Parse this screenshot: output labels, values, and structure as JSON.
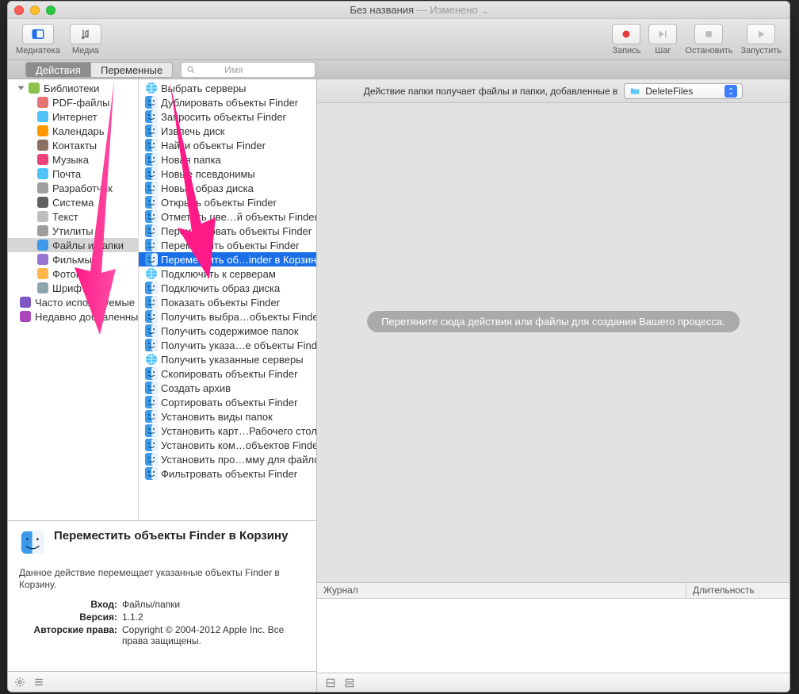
{
  "titlebar": {
    "title": "Без названия",
    "status": "Изменено"
  },
  "toolbar": {
    "library": "Медиатека",
    "media": "Медиа",
    "record": "Запись",
    "step": "Шаг",
    "stop": "Остановить",
    "run": "Запустить"
  },
  "subbar": {
    "tab_actions": "Действия",
    "tab_vars": "Переменные",
    "search_placeholder": "Имя"
  },
  "sidebar": {
    "root": "Библиотеки",
    "items": [
      "PDF-файлы",
      "Интернет",
      "Календарь",
      "Контакты",
      "Музыка",
      "Почта",
      "Разработчик",
      "Система",
      "Текст",
      "Утилиты",
      "Файлы и папки",
      "Фильмы",
      "Фотографии",
      "Шрифты"
    ],
    "extra1": "Часто используемые",
    "extra2": "Недавно добавленные"
  },
  "actions": {
    "items": [
      "Выбрать серверы",
      "Дублировать объекты Finder",
      "Запросить объекты Finder",
      "Извлечь диск",
      "Найти объекты Finder",
      "Новая папка",
      "Новые псевдонимы",
      "Новый образ диска",
      "Открыть объекты Finder",
      "Отметить цве…й объекты Finder",
      "Переименовать объекты Finder",
      "Переместить объекты Finder",
      "Переместить об…inder в Корзину",
      "Подключить к серверам",
      "Подключить образ диска",
      "Показать объекты Finder",
      "Получить выбра…объекты Finder",
      "Получить содержимое папок",
      "Получить указа…е объекты Finder",
      "Получить указанные серверы",
      "Скопировать объекты Finder",
      "Создать архив",
      "Сортировать объекты Finder",
      "Установить виды папок",
      "Установить карт…Рабочего стола",
      "Установить ком…объектов Finder",
      "Установить про…мму для файлов",
      "Фильтровать объекты Finder"
    ],
    "selected_index": 12
  },
  "detail": {
    "title": "Переместить объекты Finder в Корзину",
    "desc": "Данное действие перемещает указанные объекты Finder в Корзину.",
    "rows": {
      "input_k": "Вход:",
      "input_v": "Файлы/папки",
      "version_k": "Версия:",
      "version_v": "1.1.2",
      "copyright_k": "Авторские права:",
      "copyright_v": "Copyright © 2004-2012 Apple Inc. Все права защищены."
    }
  },
  "rightpane": {
    "header_text": "Действие папки получает файлы и папки, добавленные в",
    "folder": "DeleteFiles",
    "drop_hint": "Перетяните сюда действия или файлы для создания Вашего процесса.",
    "log_col1": "Журнал",
    "log_col2": "Длительность"
  }
}
